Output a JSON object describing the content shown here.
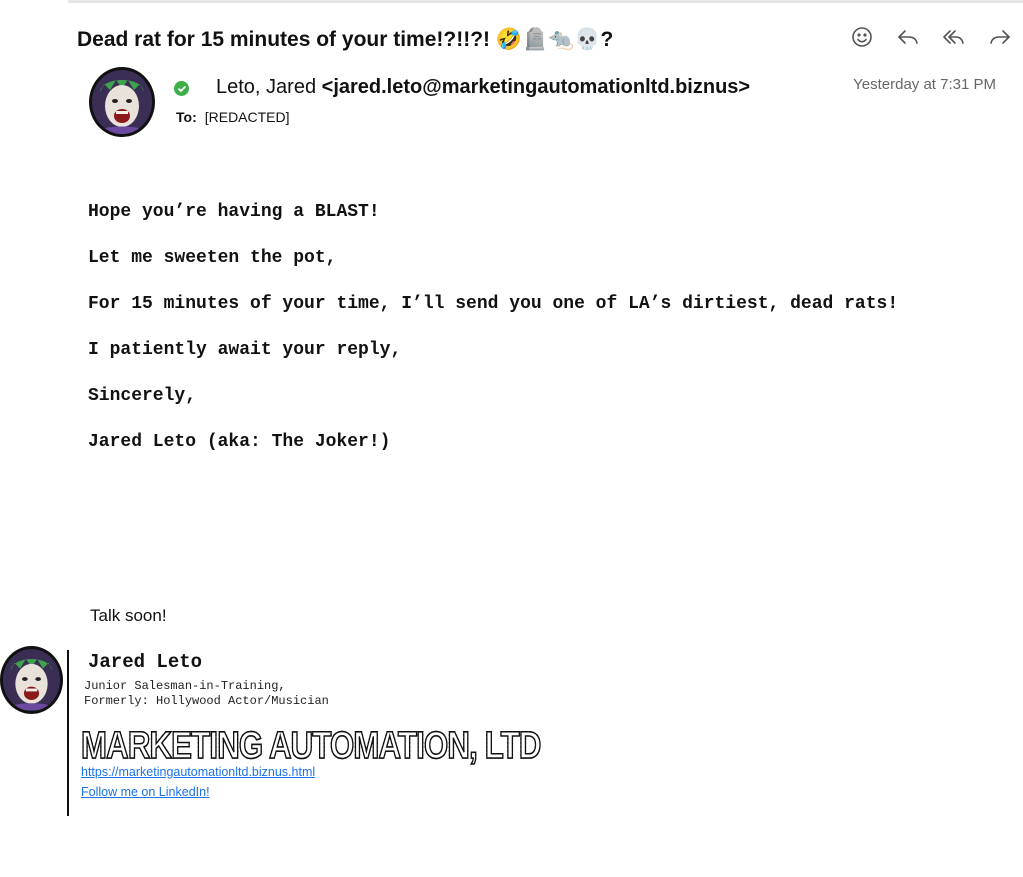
{
  "message": {
    "subject": "Dead rat for 15 minutes of your time!?!!?! 🤣🪦🐀💀?",
    "sender_name": "Leto, Jared",
    "sender_email": "<jared.leto@marketingautomationltd.biznus>",
    "date": "Yesterday at 7:31 PM",
    "to_label": "To:",
    "to_value": "[REDACTED]"
  },
  "toolbar": {
    "icons": [
      "smiley-icon",
      "reply-icon",
      "reply-all-icon",
      "forward-icon"
    ]
  },
  "body": {
    "lines": [
      "Hope you’re having a BLAST!",
      "Let me sweeten the pot,",
      "For 15 minutes of your time, I’ll send you one of LA’s dirtiest, dead rats!",
      "I patiently await your reply,",
      "Sincerely,",
      "Jared Leto (aka: The Joker!)"
    ],
    "closing": "Talk soon!"
  },
  "signature": {
    "name": "Jared Leto",
    "title_line1": "Junior Salesman-in-Training,",
    "title_line2": "Formerly: Hollywood Actor/Musician",
    "company_logo_text": "MARKETING AUTOMATION, LTD",
    "website_link": "https://marketingautomationltd.biznus.html",
    "linkedin_link": "Follow me on LinkedIn!"
  },
  "colors": {
    "verified": "#3fae49",
    "link": "#1a73e8",
    "date_text": "#666666"
  }
}
